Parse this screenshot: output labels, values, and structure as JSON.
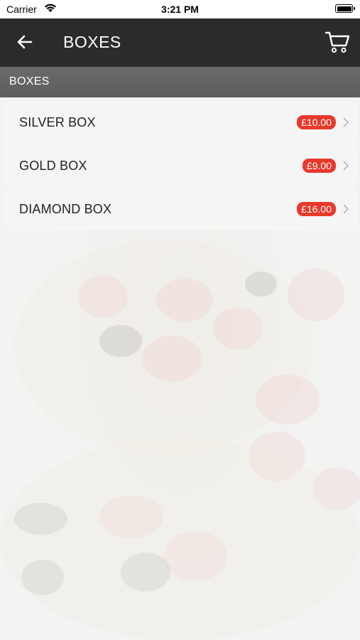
{
  "status_bar": {
    "carrier": "Carrier",
    "time": "3:21 PM"
  },
  "nav": {
    "title": "BOXES",
    "back_icon": "arrow-left-icon",
    "cart_icon": "shopping-cart-icon"
  },
  "section": {
    "title": "BOXES"
  },
  "items": [
    {
      "name": "SILVER BOX",
      "price": "£10.00"
    },
    {
      "name": "GOLD BOX",
      "price": "£9.00"
    },
    {
      "name": "DIAMOND BOX",
      "price": "£16.00"
    }
  ],
  "colors": {
    "nav_bg": "#2b2b2b",
    "section_bg": "#636363",
    "price_badge": "#e8382b"
  }
}
